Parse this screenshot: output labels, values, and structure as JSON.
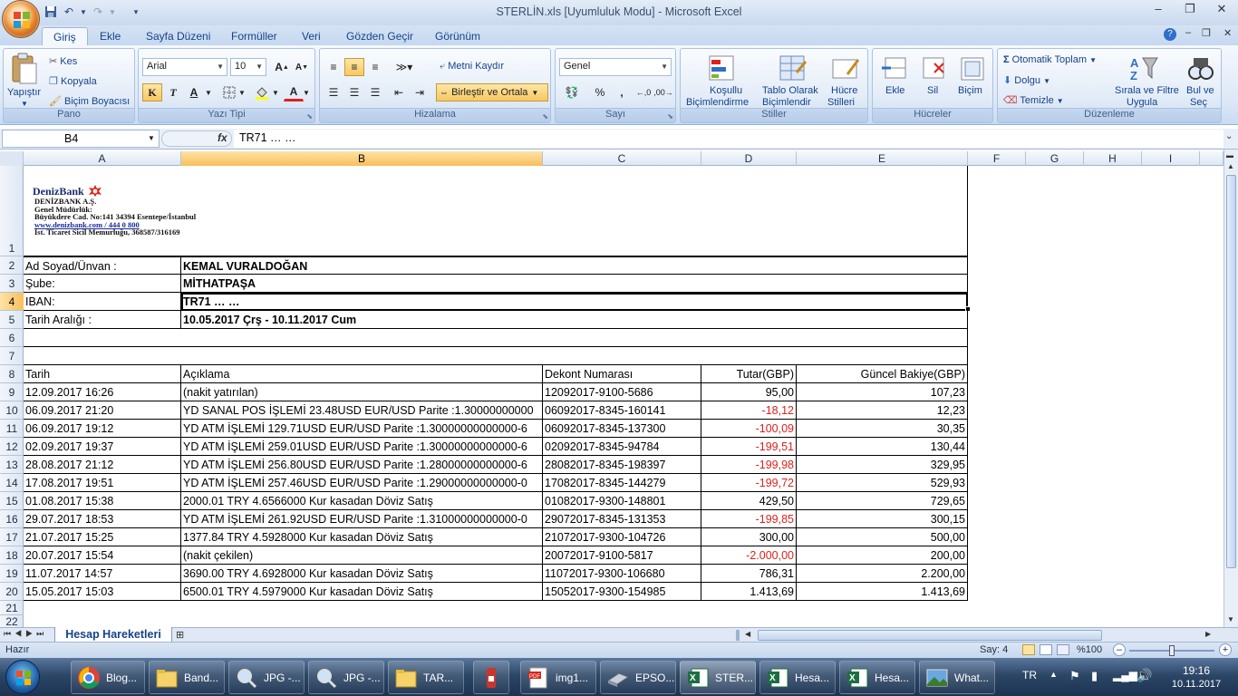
{
  "window": {
    "title": "STERLİN.xls  [Uyumluluk Modu] - Microsoft Excel"
  },
  "tabs": [
    "Giriş",
    "Ekle",
    "Sayfa Düzeni",
    "Formüller",
    "Veri",
    "Gözden Geçir",
    "Görünüm"
  ],
  "ribbon": {
    "pano": {
      "label": "Pano",
      "paste": "Yapıştır",
      "cut": "Kes",
      "copy": "Kopyala",
      "format_painter": "Biçim Boyacısı"
    },
    "yazi_tipi": {
      "label": "Yazı Tipi",
      "font": "Arial",
      "size": "10"
    },
    "hizalama": {
      "label": "Hizalama",
      "wrap": "Metni Kaydır",
      "merge": "Birleştir ve Ortala"
    },
    "sayi": {
      "label": "Sayı",
      "format": "Genel"
    },
    "stiller": {
      "label": "Stiller",
      "conditional": "Koşullu",
      "conditional2": "Biçimlendirme",
      "table": "Tablo Olarak",
      "table2": "Biçimlendir",
      "cell_styles": "Hücre",
      "cell_styles2": "Stilleri"
    },
    "hucreler": {
      "label": "Hücreler",
      "insert": "Ekle",
      "delete": "Sil",
      "format": "Biçim"
    },
    "duzenleme": {
      "label": "Düzenleme",
      "autosum": "Otomatik Toplam",
      "fill": "Dolgu",
      "clear": "Temizle",
      "sort": "Sırala ve Filtre",
      "sort2": "Uygula",
      "find": "Bul ve",
      "find2": "Seç"
    }
  },
  "formula_bar": {
    "name_box": "B4",
    "fx": "fx",
    "content": "TR71 … …"
  },
  "columns": [
    "A",
    "B",
    "C",
    "D",
    "E",
    "F",
    "G",
    "H",
    "I"
  ],
  "rows": [
    "1",
    "2",
    "3",
    "4",
    "5",
    "6",
    "7",
    "8",
    "9",
    "10",
    "11",
    "12",
    "13",
    "14",
    "15",
    "16",
    "17",
    "18",
    "19",
    "20",
    "21",
    "22"
  ],
  "header_info": {
    "bank_logo": "DenizBank",
    "bank_lines": [
      "DENİZBANK A.Ş.",
      "Genel Müdürlük:",
      "Büyükdere Cad. No:141  34394 Esentepe/İstanbul",
      "www.denizbank.com / 444 0 800",
      "İst. Ticaret Sicil Memurluğu, 368587/316169"
    ],
    "name_label": "Ad Soyad/Ünvan :",
    "name_value": "KEMAL VURALDOĞAN",
    "branch_label": "Şube:",
    "branch_value": "MİTHATPAŞA",
    "iban_label": "IBAN:",
    "iban_value": "TR71 … …",
    "range_label": "Tarih Aralığı :",
    "range_value": "10.05.2017 Çrş - 10.11.2017 Cum"
  },
  "table_headers": [
    "Tarih",
    "Açıklama",
    "Dekont Numarası",
    "Tutar(GBP)",
    "Güncel Bakiye(GBP)"
  ],
  "transactions": [
    [
      "12.09.2017 16:26",
      "(nakit yatırılan)",
      "12092017-9100-5686",
      "95,00",
      "107,23"
    ],
    [
      "06.09.2017 21:20",
      "YD SANAL POS İŞLEMİ  23.48USD EUR/USD Parite :1.30000000000",
      "06092017-8345-160141",
      "-18,12",
      "12,23"
    ],
    [
      "06.09.2017 19:12",
      "YD ATM İŞLEMİ  129.71USD EUR/USD Parite :1.30000000000000-6",
      "06092017-8345-137300",
      "-100,09",
      "30,35"
    ],
    [
      "02.09.2017 19:37",
      "YD ATM İŞLEMİ  259.01USD EUR/USD Parite :1.30000000000000-6",
      "02092017-8345-94784",
      "-199,51",
      "130,44"
    ],
    [
      "28.08.2017 21:12",
      "YD ATM İŞLEMİ  256.80USD EUR/USD Parite :1.28000000000000-6",
      "28082017-8345-198397",
      "-199,98",
      "329,95"
    ],
    [
      "17.08.2017 19:51",
      "YD ATM İŞLEMİ  257.46USD EUR/USD Parite :1.29000000000000-0",
      "17082017-8345-144279",
      "-199,72",
      "529,93"
    ],
    [
      "01.08.2017 15:38",
      " 2000.01 TRY 4.6566000 Kur  kasadan Döviz Satış",
      "01082017-9300-148801",
      "429,50",
      "729,65"
    ],
    [
      "29.07.2017 18:53",
      "YD ATM İŞLEMİ  261.92USD EUR/USD Parite :1.31000000000000-0",
      "29072017-8345-131353",
      "-199,85",
      "300,15"
    ],
    [
      "21.07.2017 15:25",
      " 1377.84 TRY 4.5928000 Kur  kasadan Döviz Satış",
      "21072017-9300-104726",
      "300,00",
      "500,00"
    ],
    [
      "20.07.2017 15:54",
      " (nakit çekilen)",
      "20072017-9100-5817",
      "-2.000,00",
      "200,00"
    ],
    [
      "11.07.2017 14:57",
      " 3690.00 TRY 4.6928000 Kur  kasadan Döviz Satış",
      "11072017-9300-106680",
      "786,31",
      "2.200,00"
    ],
    [
      "15.05.2017 15:03",
      " 6500.01 TRY 4.5979000 Kur  kasadan Döviz Satış",
      "15052017-9300-154985",
      "1.413,69",
      "1.413,69"
    ]
  ],
  "sheet_tab": "Hesap Hareketleri",
  "status": {
    "ready": "Hazır",
    "count": "Say: 4",
    "zoom": "%100"
  },
  "taskbar": {
    "items": [
      "Blog...",
      "Band...",
      "JPG -...",
      "JPG -...",
      "TAR...",
      "",
      "img1...",
      "EPSO...",
      "STER...",
      "Hesa...",
      "Hesa...",
      "What..."
    ],
    "lang": "TR",
    "time": "19:16",
    "date": "10.11.2017"
  },
  "colors": {
    "negative": "#e0201b",
    "selected_header": "#f8bf5c",
    "ribbon": "#dde8f6"
  }
}
